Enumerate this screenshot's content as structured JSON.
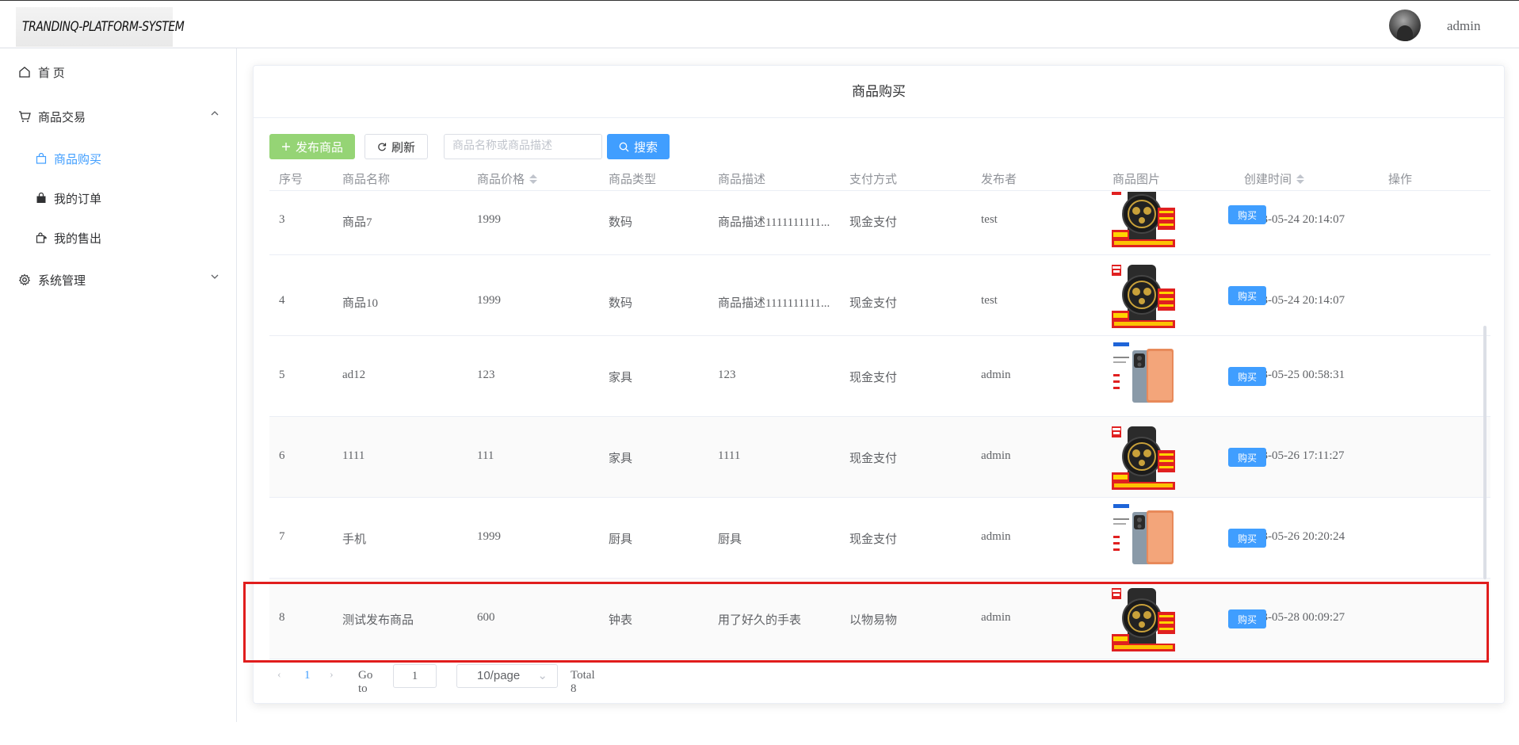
{
  "header": {
    "logo_text": "TRANDINQ-PLATFORM-SYSTEM",
    "username": "admin"
  },
  "sidebar": {
    "home": "首 页",
    "trade": "商品交易",
    "trade_items": [
      "商品购买",
      "我的订单",
      "我的售出"
    ],
    "system": "系统管理"
  },
  "page": {
    "title": "商品购买",
    "publish_label": "发布商品",
    "refresh_label": "刷新",
    "search_placeholder": "商品名称或商品描述",
    "search_label": "搜索"
  },
  "table": {
    "columns": [
      "序号",
      "商品名称",
      "商品价格",
      "商品类型",
      "商品描述",
      "支付方式",
      "发布者",
      "商品图片",
      "创建时间",
      "操作"
    ],
    "buy_label": "购买",
    "rows": [
      {
        "no": "3",
        "name": "商品7",
        "price": "1999",
        "type": "数码",
        "desc": "商品描述1111111111...",
        "pay": "现金支付",
        "publisher": "test",
        "image": "watch",
        "created": "2023-05-24 20:14:07"
      },
      {
        "no": "4",
        "name": "商品10",
        "price": "1999",
        "type": "数码",
        "desc": "商品描述1111111111...",
        "pay": "现金支付",
        "publisher": "test",
        "image": "watch",
        "created": "2023-05-24 20:14:07"
      },
      {
        "no": "5",
        "name": "ad12",
        "price": "123",
        "type": "家具",
        "desc": "123",
        "pay": "现金支付",
        "publisher": "admin",
        "image": "phone",
        "created": "2023-05-25 00:58:31"
      },
      {
        "no": "6",
        "name": "1111",
        "price": "111",
        "type": "家具",
        "desc": "1111",
        "pay": "现金支付",
        "publisher": "admin",
        "image": "watch",
        "created": "2023-05-26 17:11:27"
      },
      {
        "no": "7",
        "name": "手机",
        "price": "1999",
        "type": "厨具",
        "desc": "厨具",
        "pay": "现金支付",
        "publisher": "admin",
        "image": "phone",
        "created": "2023-05-26 20:20:24"
      },
      {
        "no": "8",
        "name": "测试发布商品",
        "price": "600",
        "type": "钟表",
        "desc": "用了好久的手表",
        "pay": "以物易物",
        "publisher": "admin",
        "image": "watch",
        "created": "2023-05-28 00:09:27"
      }
    ]
  },
  "pagination": {
    "current": "1",
    "goto_label": "Go to",
    "goto_value": "1",
    "page_size": "10/page",
    "total": "Total 8"
  },
  "colors": {
    "primary": "#409eff",
    "success_light": "#95d475",
    "highlight": "#e01d1d"
  }
}
